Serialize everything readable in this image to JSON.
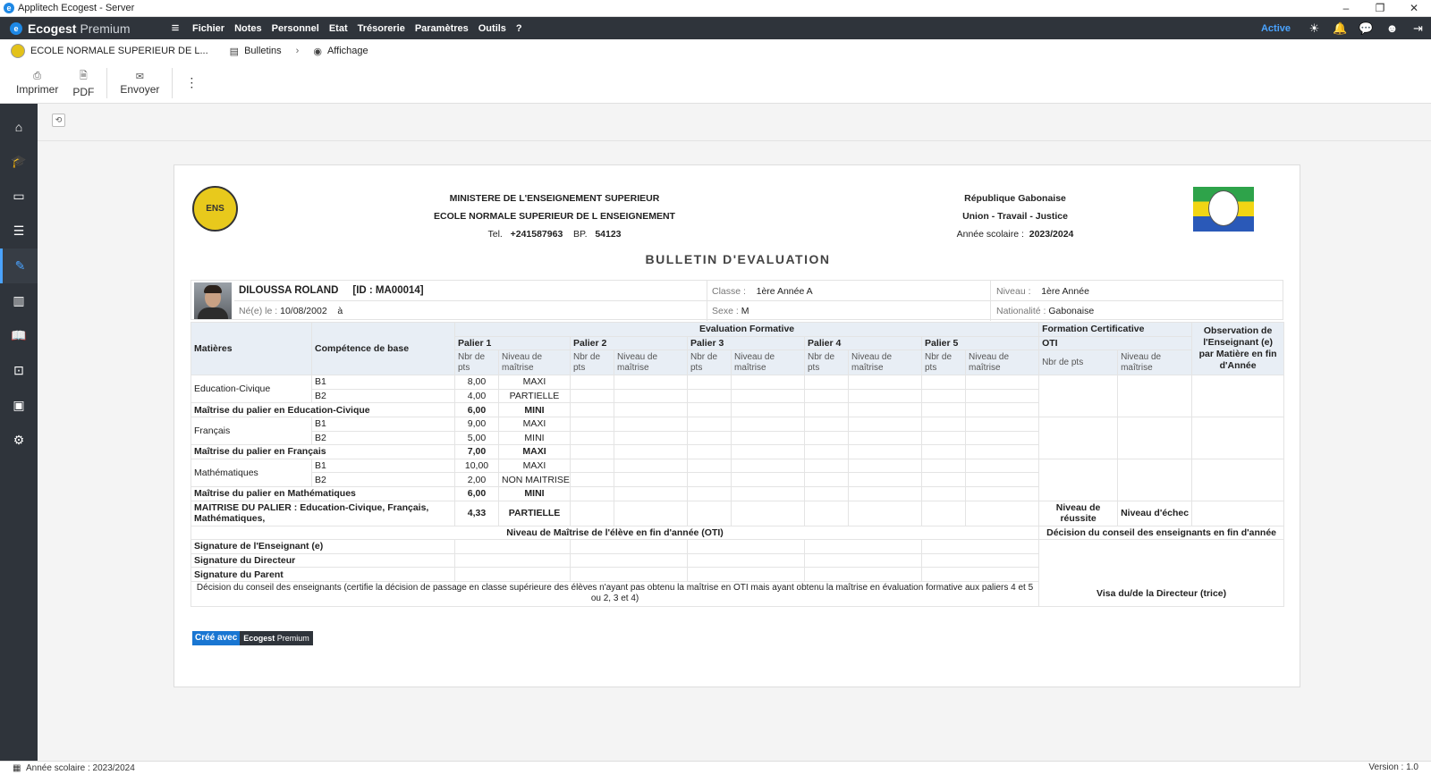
{
  "window": {
    "title": "Applitech Ecogest - Server",
    "minimize": "–",
    "restore": "❐",
    "close": "✕"
  },
  "topbar": {
    "brand_bold": "Ecogest",
    "brand_light": "Premium",
    "menu": [
      "Fichier",
      "Notes",
      "Personnel",
      "Etat",
      "Trésorerie",
      "Paramètres",
      "Outils",
      "?"
    ],
    "status": "Active"
  },
  "breadcrumb": {
    "school": "ECOLE NORMALE SUPERIEUR DE L...",
    "section": "Bulletins",
    "page": "Affichage"
  },
  "toolbar": {
    "print": "Imprimer",
    "pdf": "PDF",
    "send": "Envoyer"
  },
  "report": {
    "header_left": {
      "line1": "MINISTERE DE L'ENSEIGNEMENT SUPERIEUR",
      "line2": "ECOLE NORMALE SUPERIEUR DE L ENSEIGNEMENT",
      "tel_label": "Tel.",
      "tel": "+241587963",
      "bp_label": "BP.",
      "bp": "54123"
    },
    "header_right": {
      "line1": "République Gabonaise",
      "line2": "Union - Travail - Justice",
      "year_label": "Année scolaire :",
      "year": "2023/2024"
    },
    "title": "BULLETIN D'EVALUATION",
    "student": {
      "name": "DILOUSSA ROLAND",
      "id": "[ID : MA00014]",
      "birth_label": "Né(e) le :",
      "birth": "10/08/2002",
      "birth_place": "à",
      "class_label": "Classe :",
      "class": "1ère Année A",
      "sex_label": "Sexe :",
      "sex": "M",
      "level_label": "Niveau :",
      "level": "1ère Année",
      "nationality_label": "Nationalité :",
      "nationality": "Gabonaise"
    },
    "table": {
      "h_matieres": "Matières",
      "h_competence": "Compétence de base",
      "h_eval": "Evaluation Formative",
      "h_formation": "Formation Certificative",
      "h_oti": "OTI",
      "h_observation": "Observation de l'Enseignant (e) par Matière en fin d'Année",
      "paliers": [
        "Palier 1",
        "Palier 2",
        "Palier 3",
        "Palier 4",
        "Palier 5"
      ],
      "h_nbr": "Nbr de pts",
      "h_niveau": "Niveau de maîtrise",
      "h_nbr_oti": "Nbr de pts",
      "subjects": [
        {
          "name": "Education-Civique",
          "rows": [
            [
              "B1",
              "8,00",
              "MAXI"
            ],
            [
              "B2",
              "4,00",
              "PARTIELLE"
            ]
          ],
          "summary": "Maîtrise du palier en Education-Civique",
          "sum_pts": "6,00",
          "sum_level": "MINI"
        },
        {
          "name": "Français",
          "rows": [
            [
              "B1",
              "9,00",
              "MAXI"
            ],
            [
              "B2",
              "5,00",
              "MINI"
            ]
          ],
          "summary": "Maîtrise du palier en Français",
          "sum_pts": "7,00",
          "sum_level": "MAXI"
        },
        {
          "name": "Mathématiques",
          "rows": [
            [
              "B1",
              "10,00",
              "MAXI"
            ],
            [
              "B2",
              "2,00",
              "NON MAITRISE"
            ]
          ],
          "summary": "Maîtrise du palier en Mathématiques",
          "sum_pts": "6,00",
          "sum_level": "MINI"
        }
      ],
      "overall_label": "MAITRISE DU PALIER : Education-Civique, Français, Mathématiques,",
      "overall_pts": "4,33",
      "overall_level": "PARTIELLE",
      "reussite": "Niveau de réussite",
      "echec": "Niveau d'échec",
      "oti_level": "Niveau de Maîtrise de l'élève en fin d'année (OTI)",
      "council_decision": "Décision du conseil des enseignants en fin d'année",
      "sig_teacher": "Signature de l'Enseignant (e)",
      "sig_director": "Signature du Directeur",
      "sig_parent": "Signature du Parent",
      "council_note": "Décision du conseil des enseignants (certifie la décision de passage en classe supérieure des élèves n'ayant pas obtenu la maîtrise en OTI mais ayant obtenu la maîtrise en évaluation formative aux paliers 4 et 5 ou 2, 3 et 4)",
      "visa": "Visa du/de la Directeur (trice)"
    },
    "made_with": {
      "label": "Créé avec",
      "brand_bold": "Ecogest",
      "brand_light": "Premium"
    }
  },
  "statusbar": {
    "year": "Année scolaire : 2023/2024",
    "version": "Version : 1.0"
  }
}
